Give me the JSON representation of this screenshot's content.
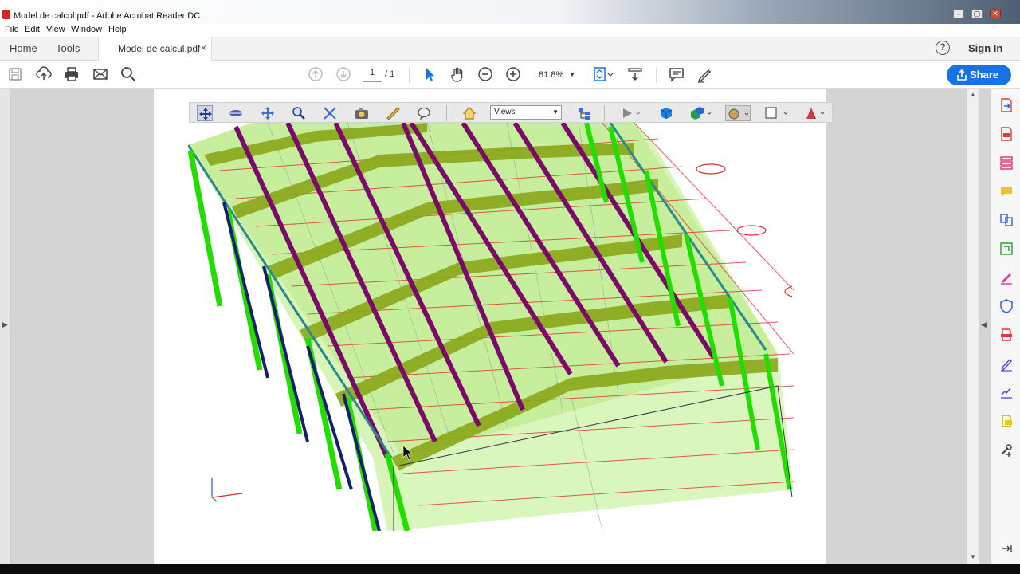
{
  "window": {
    "title": "Model de calcul.pdf - Adobe Acrobat Reader DC",
    "minimize": "–",
    "restore": "▢",
    "close": "✕"
  },
  "menu": [
    "File",
    "Edit",
    "View",
    "Window",
    "Help"
  ],
  "tabs": {
    "home": "Home",
    "tools": "Tools",
    "document": "Model de calcul.pdf",
    "close": "×",
    "help": "?",
    "signin": "Sign In"
  },
  "toolbar": {
    "page_current": "1",
    "page_total": "/ 1",
    "zoom": "81.8%",
    "zoom_caret": "▼",
    "share_label": "Share"
  },
  "toolbar_3d": {
    "views_label": "Views",
    "views_caret": "▼"
  },
  "colors": {
    "share_blue": "#1473e6",
    "frame_green": "#22dd00",
    "roof_fill": "#c8f0a0",
    "purge_purple": "#7a0a68",
    "bracing_olive": "#7a9a00",
    "grid_red": "#e23030",
    "bracing_navy": "#14206e"
  },
  "icons": {
    "toolbar": [
      "save-icon",
      "upload-icon",
      "print-icon",
      "email-icon",
      "search-icon",
      "prev-page-icon",
      "next-page-icon",
      "select-arrow-icon",
      "hand-icon",
      "zoom-out-icon",
      "zoom-in-icon",
      "fit-page-icon",
      "scroll-mode-icon",
      "comment-icon",
      "pen-icon",
      "share-icon"
    ],
    "toolbar_3d": [
      "rotate-icon",
      "spin-icon",
      "pan-icon",
      "zoom-icon",
      "walk-icon",
      "fly-icon",
      "measure-icon",
      "comment-3d-icon",
      "home-view-icon",
      "model-tree-icon",
      "animation-play-icon",
      "render-mode-icon",
      "lighting-icon",
      "background-color-icon",
      "cross-section-icon",
      "model-color-icon"
    ],
    "right_panel": [
      "export-pdf-icon",
      "create-pdf-icon",
      "organize-pages-icon",
      "comment-icon",
      "combine-files-icon",
      "edit-pdf-icon",
      "fill-sign-icon",
      "protect-icon",
      "print-production-icon",
      "sign-icon",
      "send-for-signature-icon",
      "more-tools-icon",
      "customize-icon",
      "collapse-panel-icon"
    ]
  }
}
